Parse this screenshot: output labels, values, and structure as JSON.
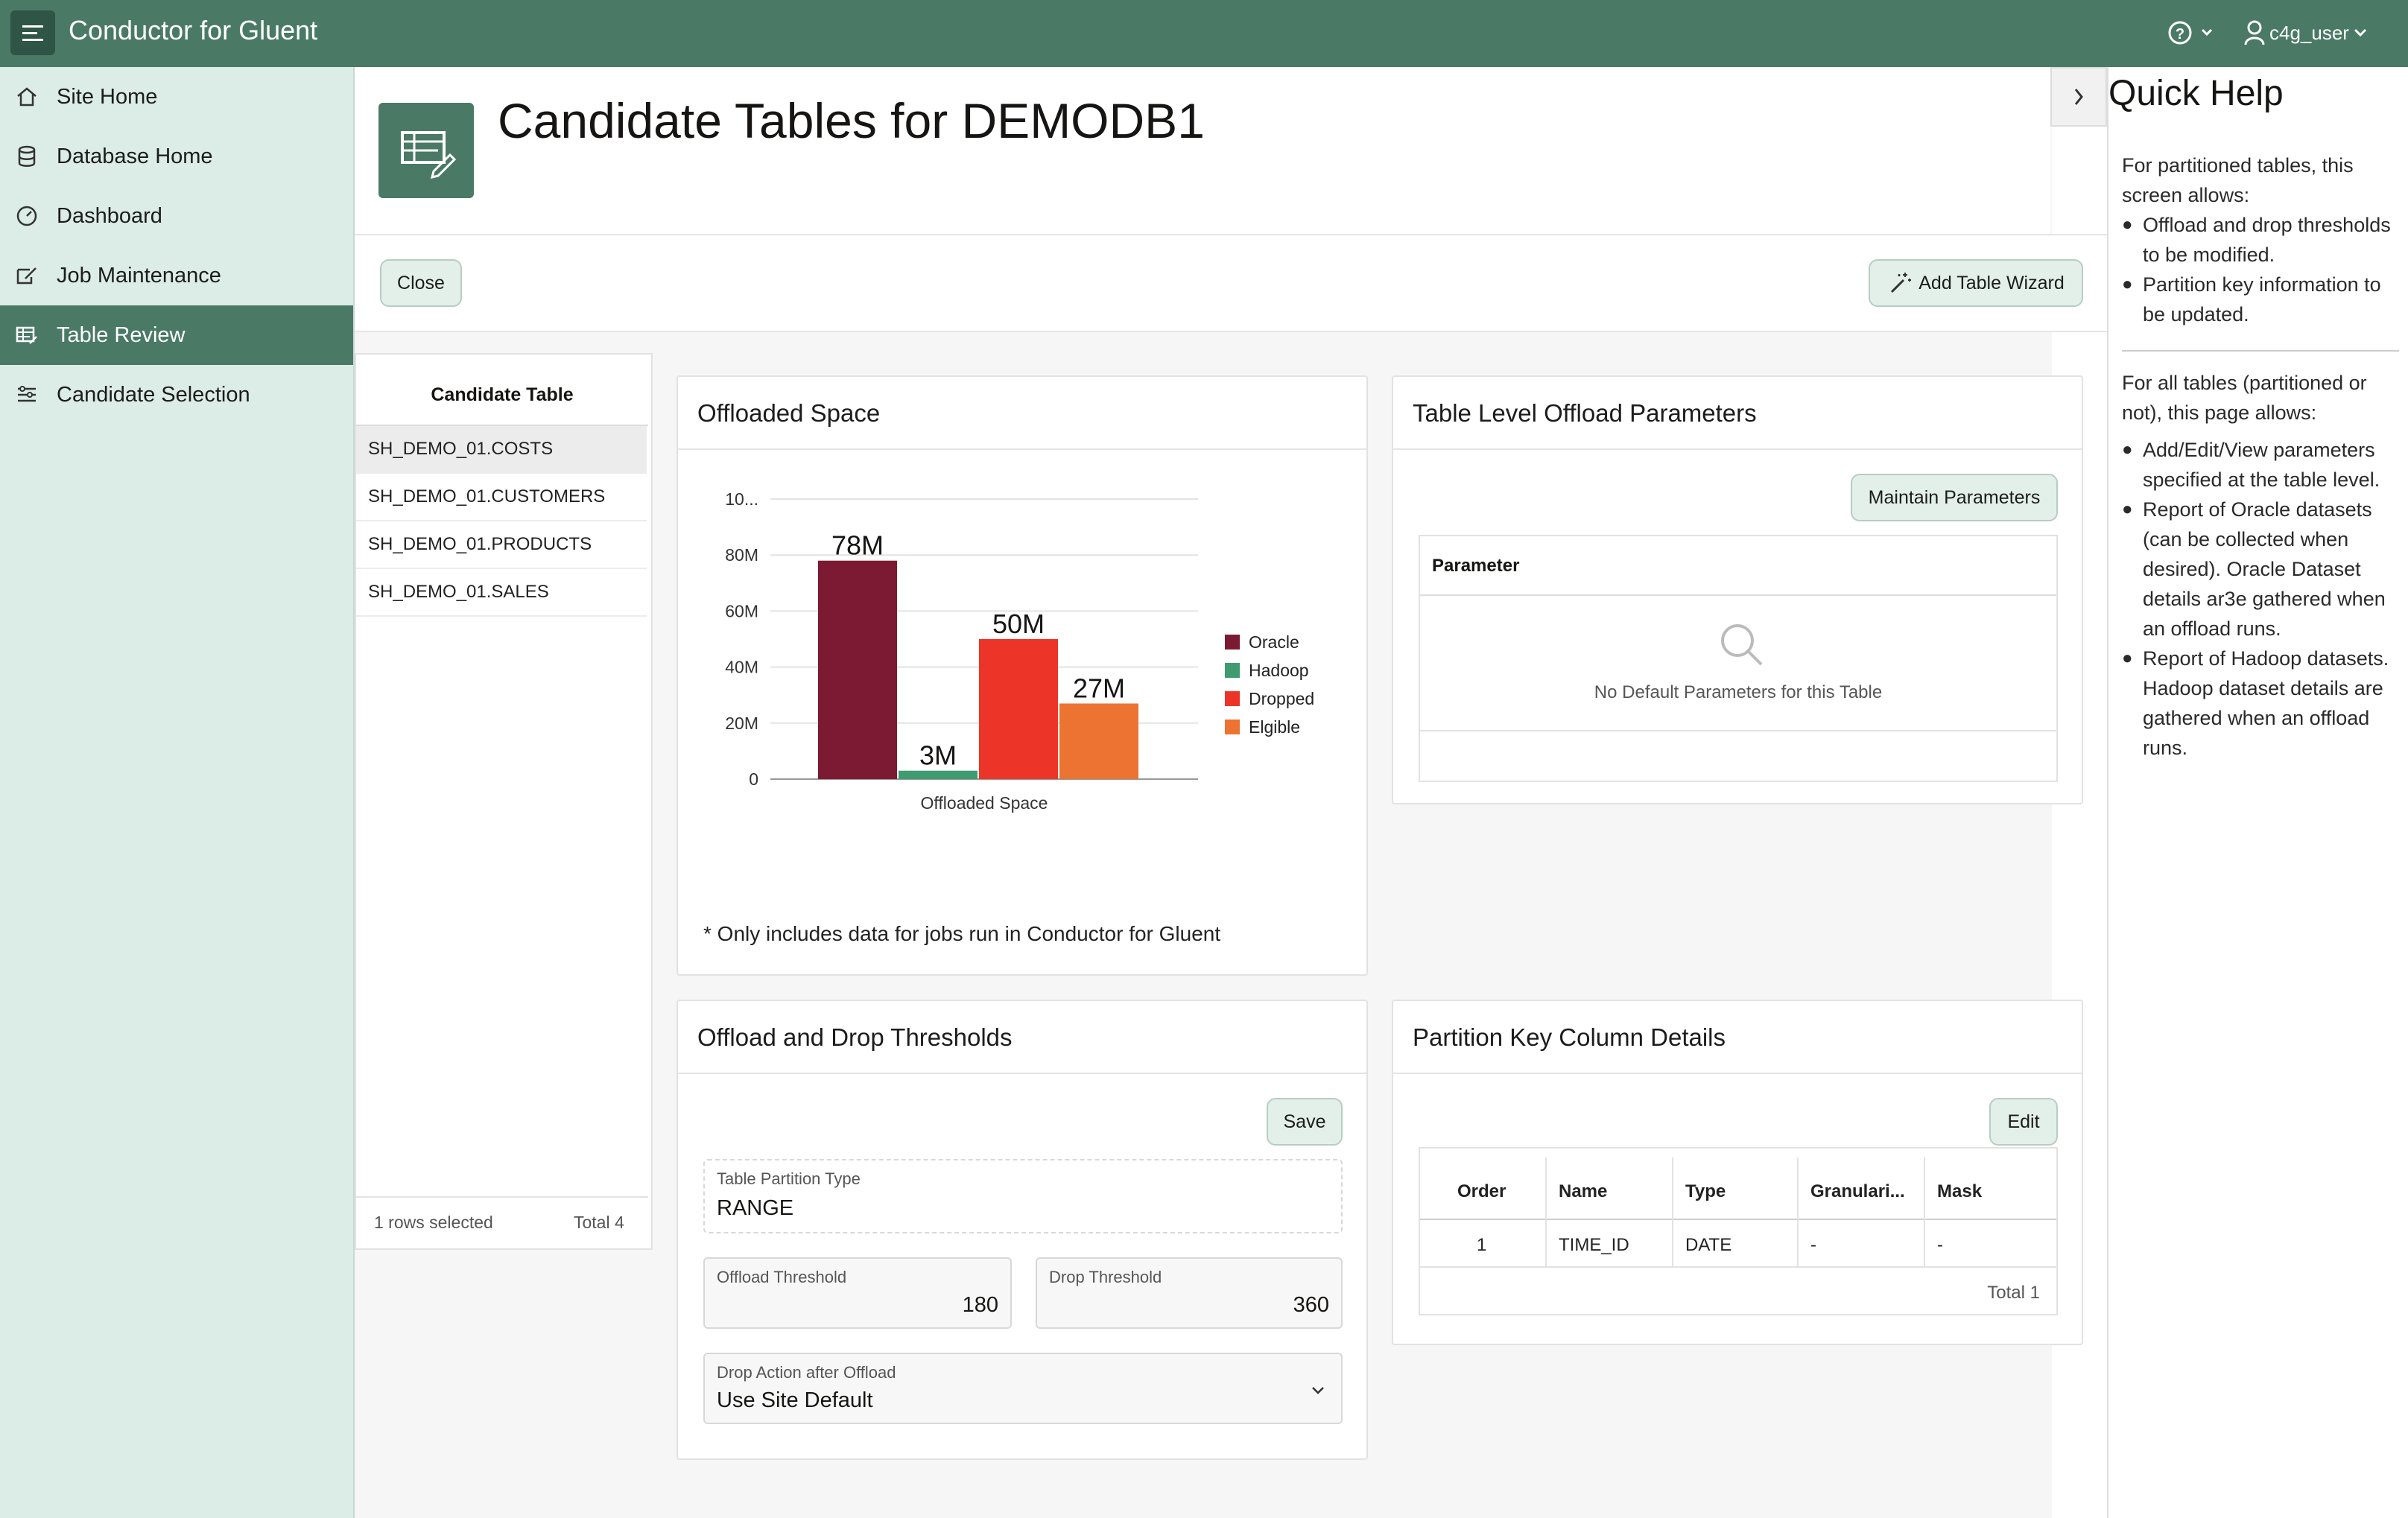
{
  "app": {
    "title": "Conductor for Gluent",
    "user": "c4g_user"
  },
  "sidebar": {
    "items": [
      {
        "label": "Site Home"
      },
      {
        "label": "Database Home"
      },
      {
        "label": "Dashboard"
      },
      {
        "label": "Job Maintenance"
      },
      {
        "label": "Table Review"
      },
      {
        "label": "Candidate Selection"
      }
    ]
  },
  "page": {
    "title": "Candidate Tables for DEMODB1"
  },
  "toolbar": {
    "close_label": "Close",
    "wizard_label": "Add Table Wizard"
  },
  "candidate_table": {
    "header": "Candidate Table",
    "rows": [
      "SH_DEMO_01.COSTS",
      "SH_DEMO_01.CUSTOMERS",
      "SH_DEMO_01.PRODUCTS",
      "SH_DEMO_01.SALES"
    ],
    "selected_text": "1 rows selected",
    "total_text": "Total 4"
  },
  "offloaded_space": {
    "title": "Offloaded Space",
    "note": "* Only includes data for jobs run in Conductor for Gluent"
  },
  "chart_data": {
    "type": "bar",
    "categories": [
      "Offloaded Space"
    ],
    "series": [
      {
        "name": "Oracle",
        "values": [
          78
        ],
        "label": "78M",
        "color": "#7d1a33"
      },
      {
        "name": "Hadoop",
        "values": [
          3
        ],
        "label": "3M",
        "color": "#3f9c70"
      },
      {
        "name": "Dropped",
        "values": [
          50
        ],
        "label": "50M",
        "color": "#ec3528"
      },
      {
        "name": "Elgible",
        "values": [
          27
        ],
        "label": "27M",
        "color": "#ec7331"
      }
    ],
    "unit": "M",
    "yticks": [
      "0",
      "20M",
      "40M",
      "60M",
      "80M",
      "10..."
    ],
    "ytick_values": [
      0,
      20,
      40,
      60,
      80,
      100
    ],
    "ylim": [
      0,
      100
    ],
    "xlabel": "Offloaded Space",
    "grid": true,
    "legend": "right"
  },
  "offload_params": {
    "title": "Table Level Offload Parameters",
    "maintain_label": "Maintain Parameters",
    "col_header": "Parameter",
    "empty_text": "No Default Parameters for this Table"
  },
  "thresholds": {
    "title": "Offload and Drop Thresholds",
    "save_label": "Save",
    "partition_type_label": "Table Partition Type",
    "partition_type_value": "RANGE",
    "offload_label": "Offload Threshold",
    "offload_value": "180",
    "drop_label": "Drop Threshold",
    "drop_value": "360",
    "action_label": "Drop Action after Offload",
    "action_value": "Use Site Default"
  },
  "partition_key": {
    "title": "Partition Key Column Details",
    "edit_label": "Edit",
    "headers": [
      "Order",
      "Name",
      "Type",
      "Granulari...",
      "Mask"
    ],
    "rows": [
      [
        "1",
        "TIME_ID",
        "DATE",
        "-",
        "-"
      ]
    ],
    "total_text": "Total 1"
  },
  "quick_help": {
    "title": "Quick Help",
    "p1": "For partitioned tables, this screen allows:",
    "b1": [
      "Offload and drop thresholds to be modified.",
      "Partition key information to be updated."
    ],
    "p2": "For all tables (partitioned or not), this page allows:",
    "b2": [
      "Add/Edit/View parameters specified at the table level.",
      "Report of Oracle datasets (can be collected when desired). Oracle Dataset details ar3e gathered when an offload runs.",
      "Report of Hadoop datasets. Hadoop dataset details are gathered when an offload runs."
    ]
  },
  "colors": {
    "brand": "#4a7a66",
    "sidebar_bg": "#dcece6",
    "accent_btn": "#e3f0ea"
  }
}
